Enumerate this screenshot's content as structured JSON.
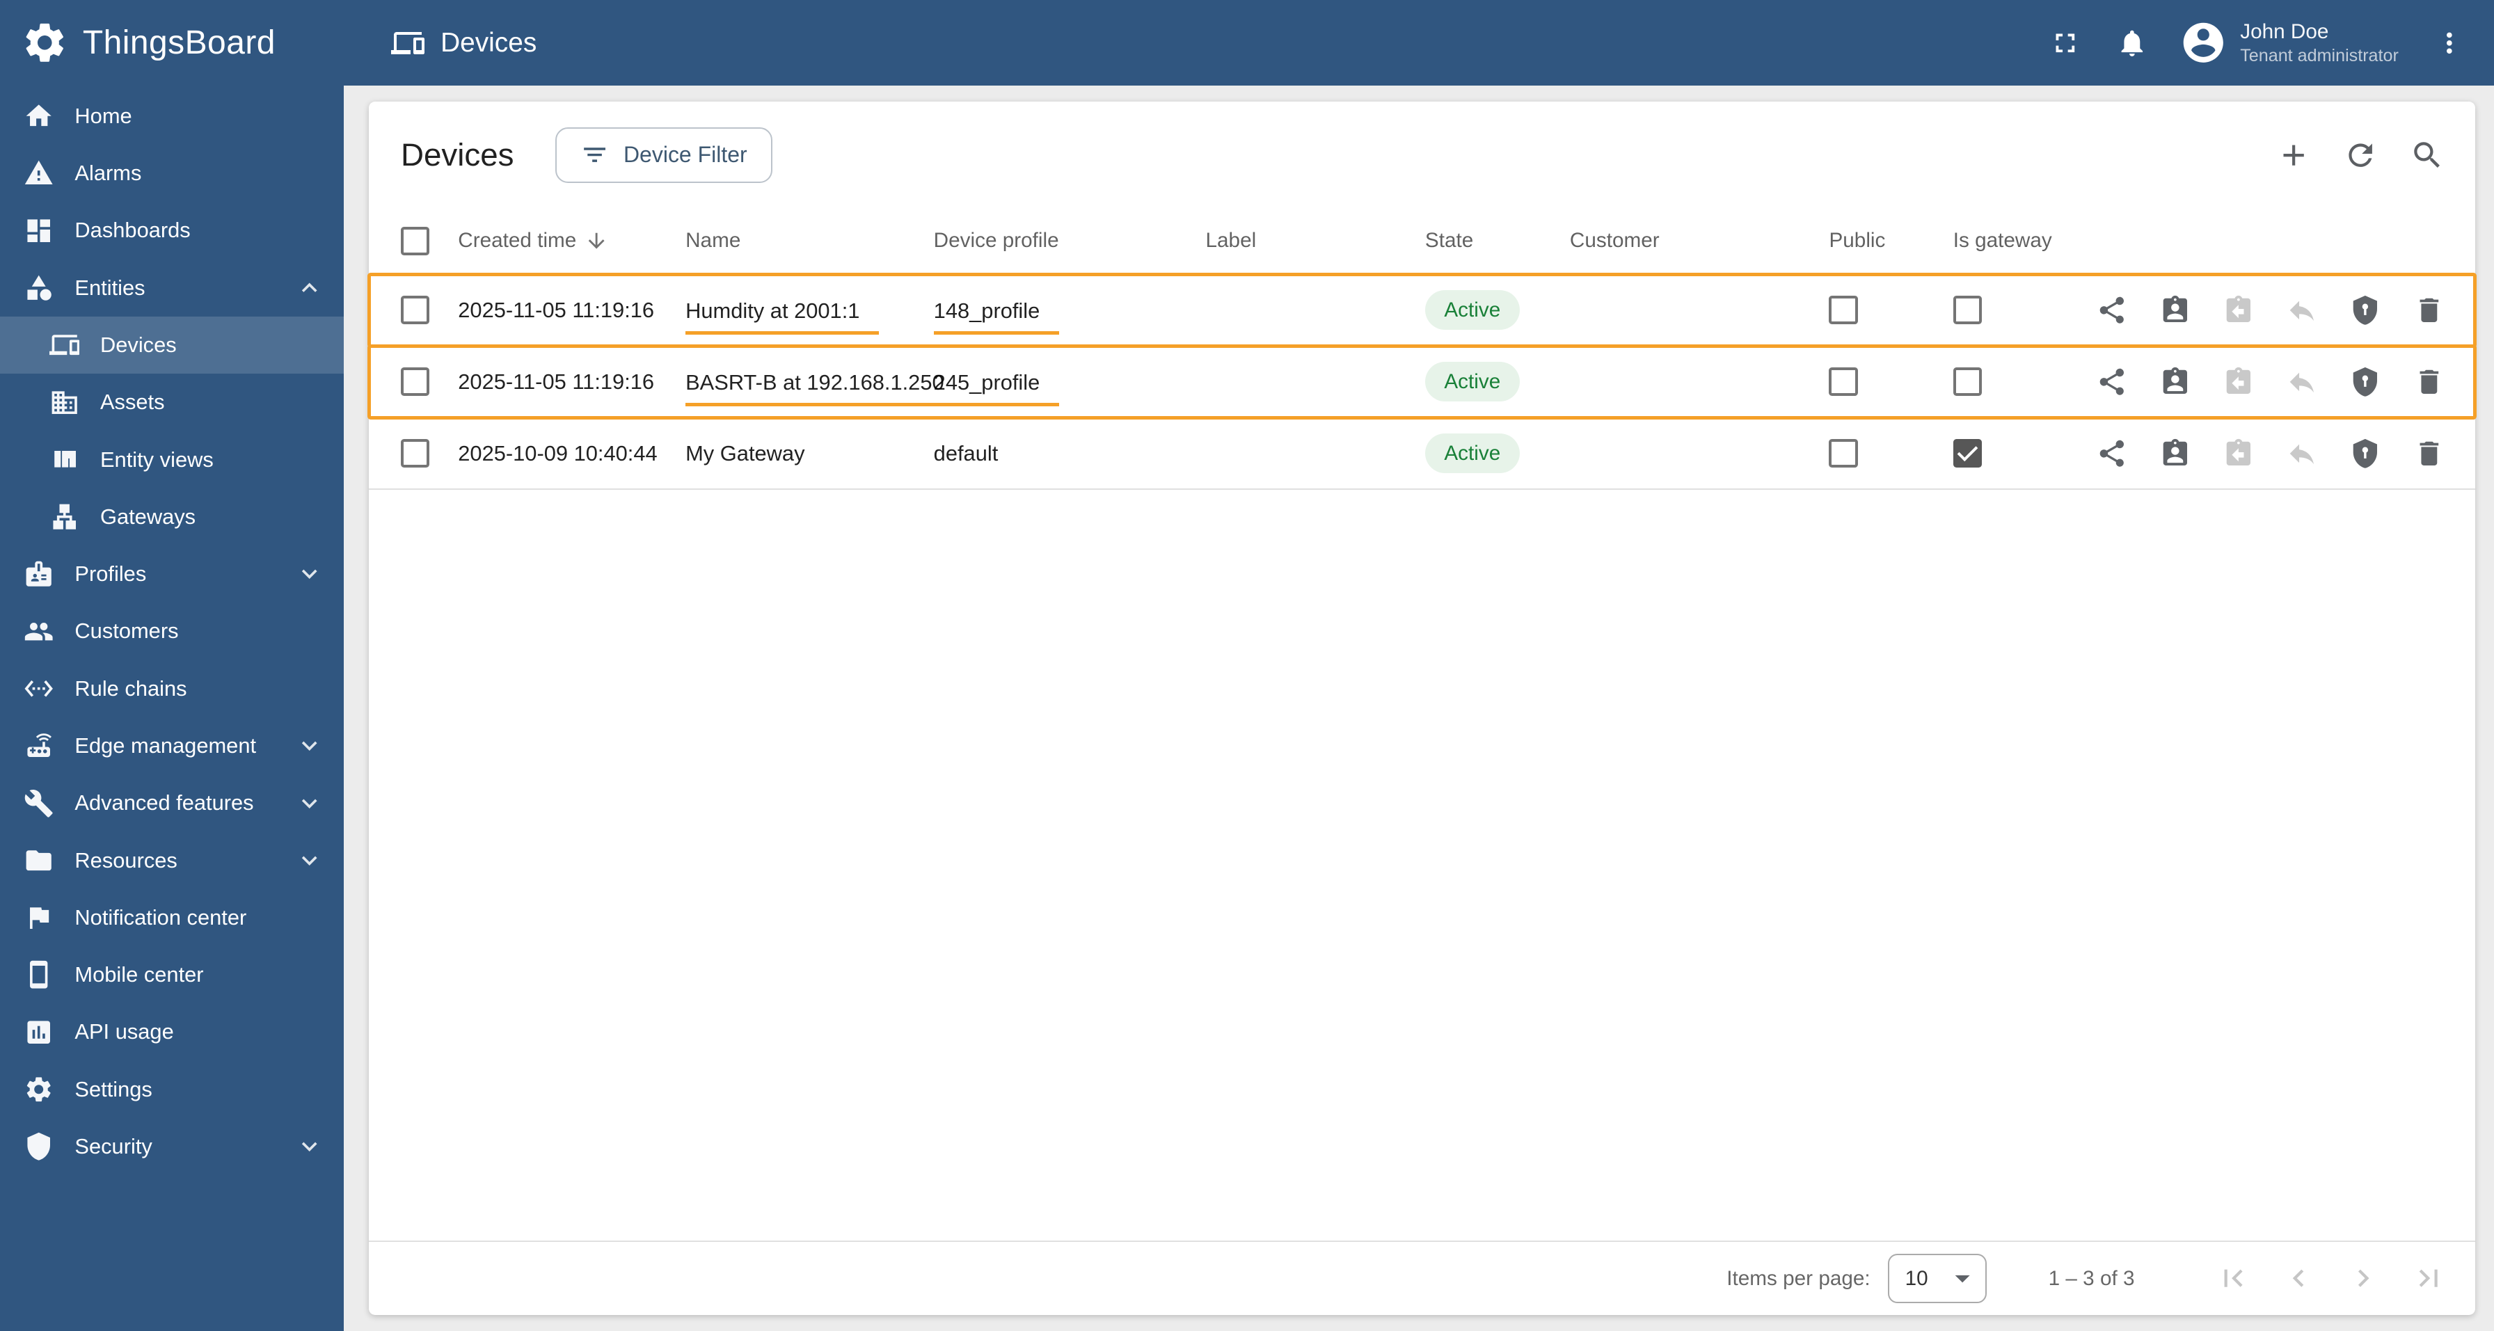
{
  "brand": {
    "app_name": "ThingsBoard"
  },
  "topbar": {
    "page_title": "Devices",
    "user_name": "John Doe",
    "user_role": "Tenant administrator",
    "icons": [
      "fullscreen-icon",
      "notifications-bell-icon",
      "account-avatar-icon",
      "more-vert-icon"
    ]
  },
  "sidebar": {
    "items": [
      {
        "label": "Home",
        "icon": "home"
      },
      {
        "label": "Alarms",
        "icon": "warning"
      },
      {
        "label": "Dashboards",
        "icon": "dashboards"
      },
      {
        "label": "Entities",
        "icon": "entities",
        "expandable": true,
        "expanded": true
      },
      {
        "label": "Devices",
        "icon": "devices",
        "child": true,
        "selected": true
      },
      {
        "label": "Assets",
        "icon": "assets",
        "child": true
      },
      {
        "label": "Entity views",
        "icon": "entity-views",
        "child": true
      },
      {
        "label": "Gateways",
        "icon": "gateways",
        "child": true
      },
      {
        "label": "Profiles",
        "icon": "profiles",
        "expandable": true,
        "expanded": false
      },
      {
        "label": "Customers",
        "icon": "customers"
      },
      {
        "label": "Rule chains",
        "icon": "rule-chains"
      },
      {
        "label": "Edge management",
        "icon": "edge",
        "expandable": true,
        "expanded": false
      },
      {
        "label": "Advanced features",
        "icon": "advanced",
        "expandable": true,
        "expanded": false
      },
      {
        "label": "Resources",
        "icon": "resources",
        "expandable": true,
        "expanded": false
      },
      {
        "label": "Notification center",
        "icon": "notification"
      },
      {
        "label": "Mobile center",
        "icon": "mobile"
      },
      {
        "label": "API usage",
        "icon": "api"
      },
      {
        "label": "Settings",
        "icon": "settings"
      },
      {
        "label": "Security",
        "icon": "security",
        "expandable": true,
        "expanded": false
      }
    ]
  },
  "main": {
    "title": "Devices",
    "filter_button_label": "Device Filter",
    "header_icons": [
      "add-icon",
      "refresh-icon",
      "search-icon"
    ],
    "table": {
      "columns": [
        "Created time",
        "Name",
        "Device profile",
        "Label",
        "State",
        "Customer",
        "Public",
        "Is gateway"
      ],
      "sort": {
        "column": "Created time",
        "direction": "desc"
      },
      "rows": [
        {
          "created": "2025-11-05 11:19:16",
          "name": "Humdity at 2001:1",
          "profile": "148_profile",
          "label": "",
          "state": "Active",
          "customer": "",
          "public": false,
          "gateway": false,
          "annotated": true
        },
        {
          "created": "2025-11-05 11:19:16",
          "name": "BASRT-B at 192.168.1.250",
          "profile": "245_profile",
          "label": "",
          "state": "Active",
          "customer": "",
          "public": false,
          "gateway": false,
          "annotated": true
        },
        {
          "created": "2025-10-09 10:40:44",
          "name": "My Gateway",
          "profile": "default",
          "label": "",
          "state": "Active",
          "customer": "",
          "public": false,
          "gateway": true,
          "annotated": false
        }
      ],
      "row_actions": [
        {
          "id": "make-public",
          "icon": "share",
          "enabled": true
        },
        {
          "id": "assign-to-customer",
          "icon": "assignment-ind",
          "enabled": true
        },
        {
          "id": "unassign-from-customer",
          "icon": "assignment-return",
          "enabled": false
        },
        {
          "id": "make-private",
          "icon": "reply",
          "enabled": false
        },
        {
          "id": "manage-credentials",
          "icon": "shield-key",
          "enabled": true
        },
        {
          "id": "delete",
          "icon": "trash",
          "enabled": true
        }
      ]
    },
    "pagination": {
      "items_per_page_label": "Items per page:",
      "page_size": "10",
      "range_label": "1 – 3 of 3",
      "pager_icons": [
        "first-page-icon",
        "chevron-left-icon",
        "chevron-right-icon",
        "last-page-icon"
      ]
    }
  },
  "colors": {
    "primary": "#305680",
    "annotation": "#F5A028",
    "state_active_bg": "#E7F3E9",
    "state_active_text": "#198038"
  }
}
